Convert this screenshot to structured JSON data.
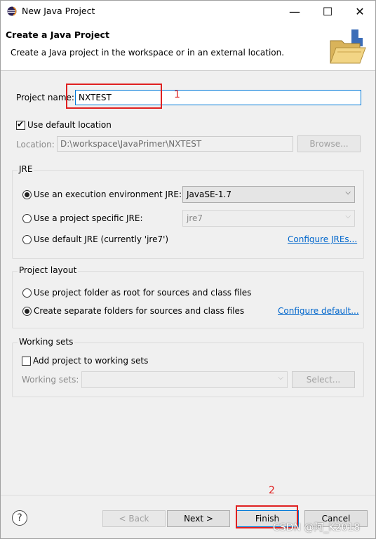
{
  "window": {
    "title": "New Java Project",
    "minimize": "—",
    "maximize": "☐",
    "close": "✕"
  },
  "banner": {
    "title": "Create a Java Project",
    "description": "Create a Java project in the workspace or in an external location."
  },
  "project_name": {
    "label": "Project name:",
    "value": "NXTEST"
  },
  "location": {
    "use_default_label": "Use default location",
    "use_default_checked": true,
    "label": "Location:",
    "value": "D:\\workspace\\JavaPrimer\\NXTEST",
    "browse_label": "Browse..."
  },
  "jre": {
    "group_title": "JRE",
    "option_env_label": "Use an execution environment JRE:",
    "option_env_value": "JavaSE-1.7",
    "option_specific_label": "Use a project specific JRE:",
    "option_specific_value": "jre7",
    "option_default_label": "Use default JRE (currently 'jre7')",
    "configure_link": "Configure JREs...",
    "selected": "env"
  },
  "project_layout": {
    "group_title": "Project layout",
    "option_root_label": "Use project folder as root for sources and class files",
    "option_separate_label": "Create separate folders for sources and class files",
    "configure_link": "Configure default...",
    "selected": "separate"
  },
  "working_sets": {
    "group_title": "Working sets",
    "add_label": "Add project to working sets",
    "add_checked": false,
    "label": "Working sets:",
    "value": "",
    "select_label": "Select..."
  },
  "buttons": {
    "help": "?",
    "back": "< Back",
    "next": "Next >",
    "finish": "Finish",
    "cancel": "Cancel"
  },
  "annotations": {
    "one": "1",
    "two": "2"
  },
  "watermark": "CSDN @阿_K2018",
  "colors": {
    "accent": "#0078d7",
    "annotation": "#e02020",
    "link": "#0066cc"
  }
}
